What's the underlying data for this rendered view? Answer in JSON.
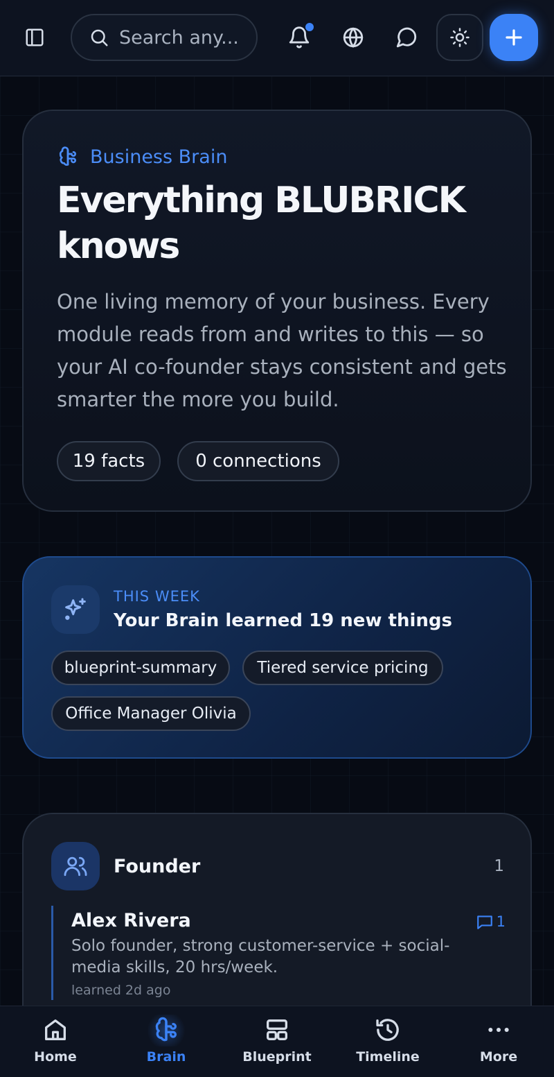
{
  "header": {
    "search_placeholder": "Search any...",
    "has_notification": true
  },
  "hero": {
    "label": "Business Brain",
    "title": "Everything BLUBRICK knows",
    "description": "One living memory of your business. Every module reads from and writes to this — so your AI co-founder stays consistent and gets smarter the more you build.",
    "facts_pill": "19 facts",
    "connections_pill": "0 connections"
  },
  "this_week": {
    "kicker": "THIS WEEK",
    "title": "Your Brain learned 19 new things",
    "tags": [
      "blueprint-summary",
      "Tiered service pricing",
      "Office Manager Olivia"
    ]
  },
  "founder": {
    "title": "Founder",
    "count": "1",
    "fact": {
      "name": "Alex Rivera",
      "description": "Solo founder, strong customer-service + social-media skills, 20 hrs/week.",
      "learned": "learned 2d ago",
      "comments": "1"
    }
  },
  "bottom_nav": {
    "items": [
      {
        "label": "Home",
        "icon": "home-icon"
      },
      {
        "label": "Brain",
        "icon": "brain-icon",
        "active": true
      },
      {
        "label": "Blueprint",
        "icon": "layout-icon"
      },
      {
        "label": "Timeline",
        "icon": "history-icon"
      },
      {
        "label": "More",
        "icon": "more-icon"
      }
    ]
  },
  "colors": {
    "accent": "#3b82f6",
    "background": "#070b14",
    "card": "#111827",
    "week_card": "#163562"
  }
}
